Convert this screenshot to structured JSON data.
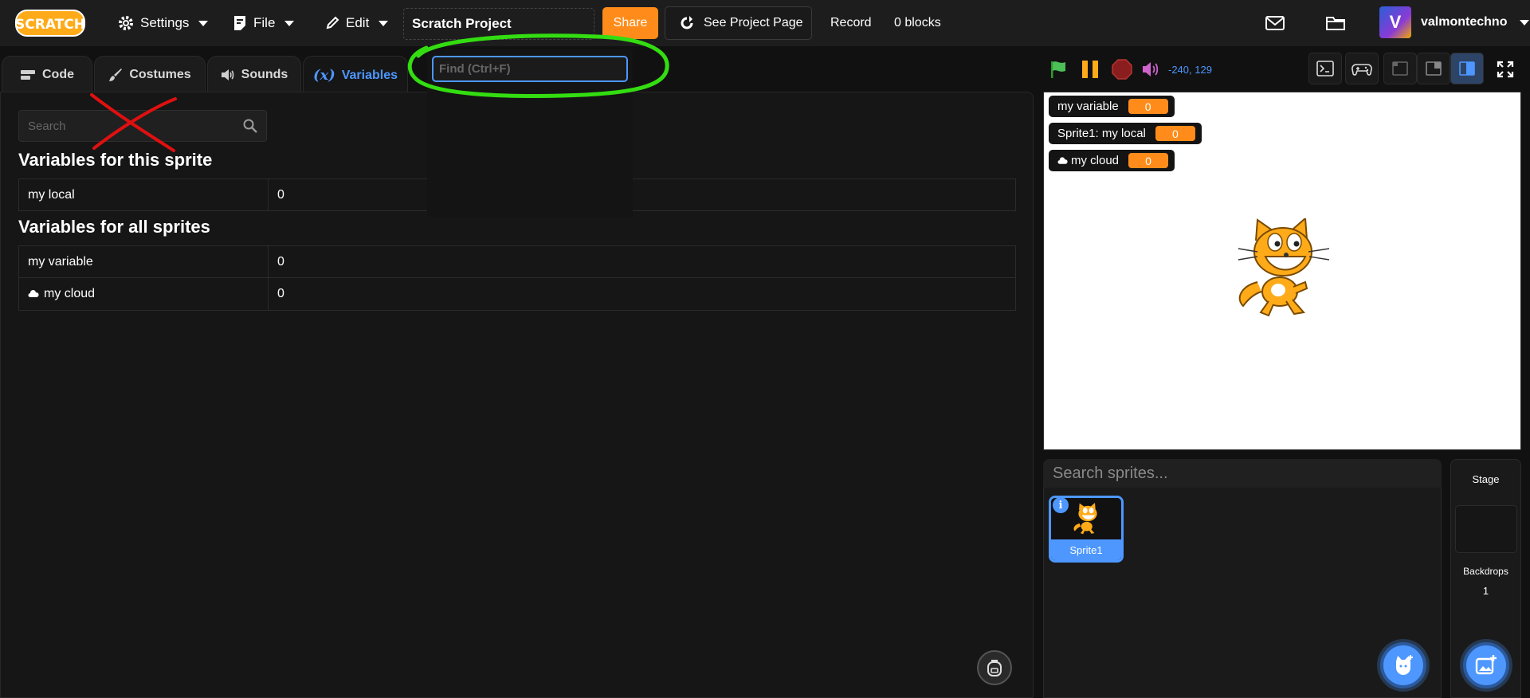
{
  "menubar": {
    "logo_text": "SCRATCH",
    "settings_label": "Settings",
    "file_label": "File",
    "edit_label": "Edit",
    "project_title": "Scratch Project",
    "share_label": "Share",
    "see_project_page_label": "See Project Page",
    "record_label": "Record",
    "blocks_count": "0 blocks",
    "username": "valmontechno",
    "avatar_letter": "V"
  },
  "tabs": [
    {
      "label": "Code",
      "icon": "code-icon"
    },
    {
      "label": "Costumes",
      "icon": "brush-icon"
    },
    {
      "label": "Sounds",
      "icon": "speaker-icon"
    },
    {
      "label": "Variables",
      "icon": "variable-icon",
      "active": true
    }
  ],
  "find": {
    "placeholder": "Find (Ctrl+F)"
  },
  "variables_pane": {
    "search_placeholder": "Search",
    "sprite_section_title": "Variables for this sprite",
    "sprite_vars": [
      {
        "name": "my local",
        "value": "0"
      }
    ],
    "global_section_title": "Variables for all sprites",
    "global_vars": [
      {
        "name": "my variable",
        "value": "0",
        "cloud": false
      },
      {
        "name": "my cloud",
        "value": "0",
        "cloud": true
      }
    ]
  },
  "stage_controls": {
    "coordinates": "-240, 129"
  },
  "monitors": [
    {
      "label": "my variable",
      "value": "0"
    },
    {
      "label": "Sprite1: my local",
      "value": "0"
    },
    {
      "label": "my cloud",
      "value": "0",
      "cloud": true
    }
  ],
  "sprites": {
    "search_placeholder": "Search sprites...",
    "items": [
      {
        "name": "Sprite1",
        "selected": true
      }
    ]
  },
  "stage_pane": {
    "title": "Stage",
    "backdrops_label": "Backdrops",
    "backdrops_count": "1"
  },
  "colors": {
    "accent": "#4d97ff",
    "share": "#ff8c1a",
    "annotation_green": "#33dd11",
    "annotation_red": "#e01010"
  }
}
